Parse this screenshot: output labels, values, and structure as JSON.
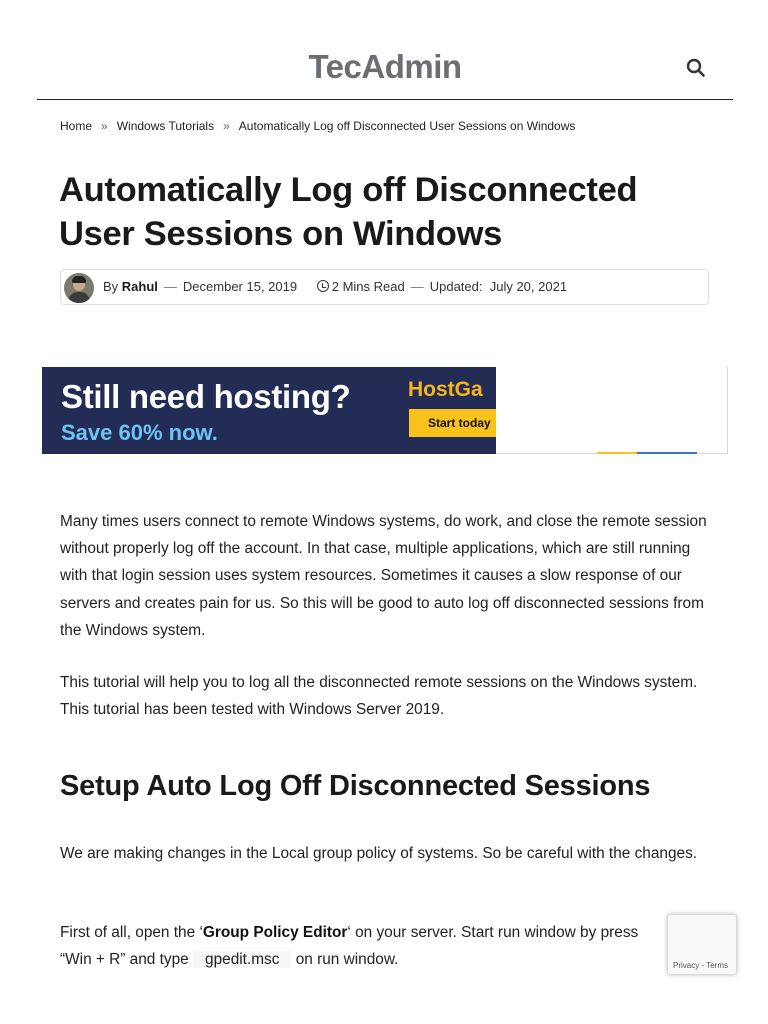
{
  "header": {
    "logo": "TecAdmin",
    "search_icon": "search-icon"
  },
  "breadcrumb": {
    "items": [
      "Home",
      "Windows Tutorials",
      "Automatically Log off Disconnected User Sessions on Windows"
    ],
    "separator": "»"
  },
  "article": {
    "title": "Automatically Log off Disconnected User Sessions on Windows",
    "meta": {
      "by": "By",
      "author": "Rahul",
      "date": "December 15, 2019",
      "read_time": "2 Mins Read",
      "updated_label": "Updated:",
      "updated_date": "July 20, 2021",
      "dash": "—"
    },
    "paragraphs": [
      "Many times users connect to remote Windows systems, do work, and close the remote session without properly log off the account. In that case, multiple applications, which are still running with that login session uses system resources. Sometimes it causes a slow response of our servers and creates pain for us. So this will be good to auto log off disconnected sessions from the Windows system.",
      "This tutorial will help you to log all the disconnected remote sessions on the Windows system. This tutorial has been tested with Windows Server 2019."
    ],
    "section_heading": "Setup Auto Log Off Disconnected Sessions",
    "section_paragraph": "We are making changes in the Local group policy of systems. So be careful with the changes.",
    "last_paragraph": {
      "prefix": "First of all, open the ‘",
      "bold": "Group Policy Editor",
      "middle": "‘ on your server. Start run window by press",
      "line2": "“Win + R” and type ",
      "code": "gpedit.msc",
      "suffix": " on run window."
    }
  },
  "ad": {
    "headline": "Still need hosting?",
    "subline": "Save 60% now.",
    "brand": "HostGa",
    "cta": "Start today",
    "colors": {
      "background": "#222c55",
      "accent": "#f8b51b",
      "sub": "#6fc3f4"
    }
  },
  "recaptcha": {
    "privacy": "Privacy",
    "separator": " - ",
    "terms": "Terms"
  }
}
